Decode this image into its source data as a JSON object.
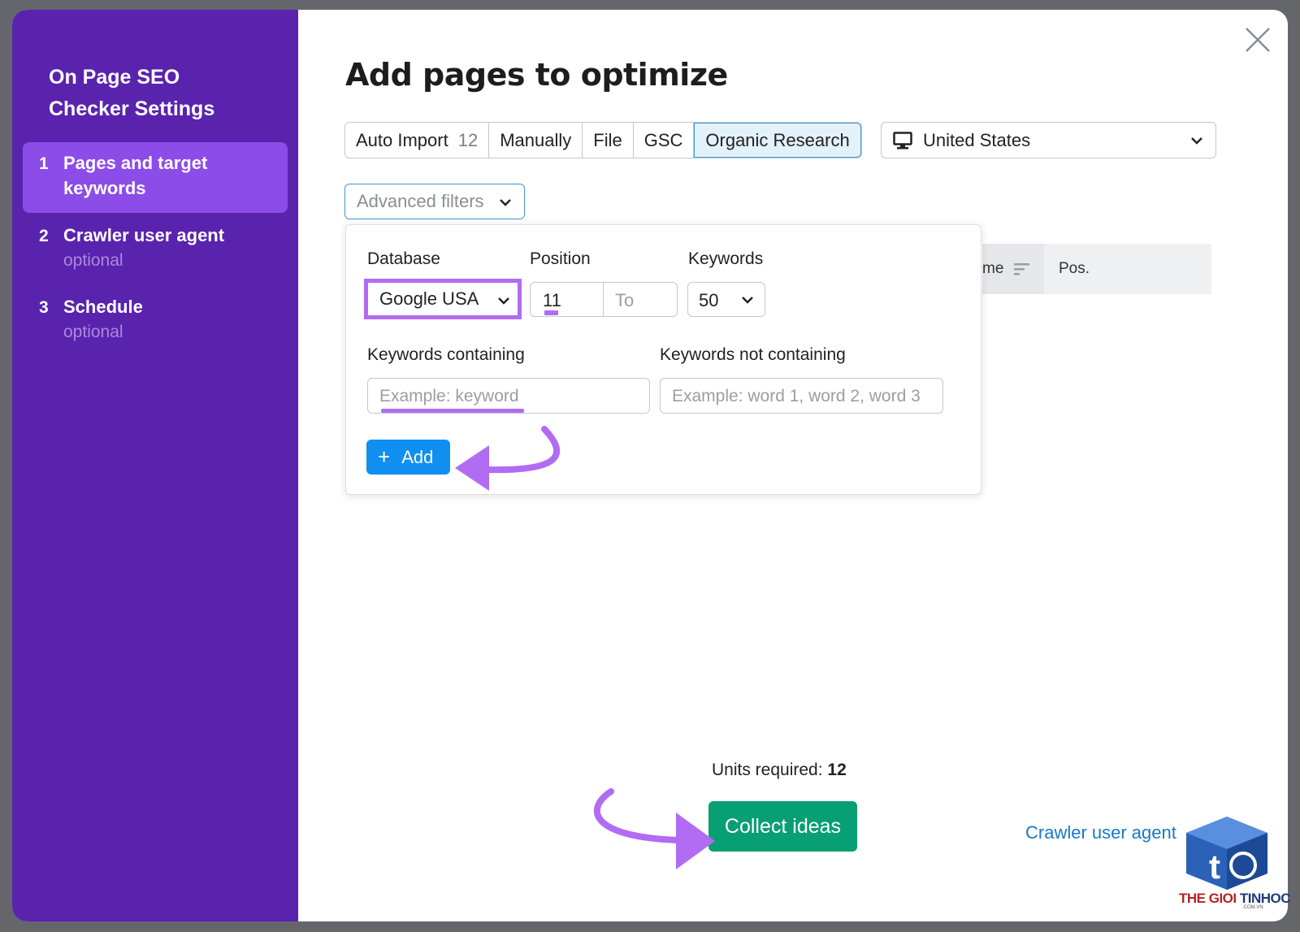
{
  "sidebar": {
    "title": "On Page SEO Checker Settings",
    "steps": [
      {
        "num": "1",
        "label": "Pages and target keywords",
        "optional": ""
      },
      {
        "num": "2",
        "label": "Crawler user agent",
        "optional": "optional"
      },
      {
        "num": "3",
        "label": "Schedule",
        "optional": "optional"
      }
    ]
  },
  "main": {
    "title": "Add pages to optimize",
    "tabs": [
      {
        "label": "Auto Import",
        "count": "12"
      },
      {
        "label": "Manually"
      },
      {
        "label": "File"
      },
      {
        "label": "GSC"
      },
      {
        "label": "Organic Research"
      }
    ],
    "country": "United States",
    "advanced_filters": "Advanced filters",
    "table_head": {
      "name_col": "me",
      "pos_col": "Pos."
    },
    "filters": {
      "database_label": "Database",
      "database_value": "Google USA",
      "position_label": "Position",
      "position_from": "11",
      "position_to_placeholder": "To",
      "keywords_label": "Keywords",
      "keywords_value": "50",
      "containing_label": "Keywords containing",
      "containing_placeholder": "Example: keyword",
      "not_containing_label": "Keywords not containing",
      "not_containing_placeholder": "Example: word 1, word 2, word 3",
      "add_label": "Add"
    },
    "units_label": "Units required:",
    "units_value": "12",
    "collect_label": "Collect ideas",
    "next_link": "Crawler user agent"
  },
  "watermark": {
    "brand_a": "THE GIOI",
    "brand_b": "TINHOC",
    "domain": ".COM.VN"
  },
  "colors": {
    "sidebar": "#5a23ae",
    "active_step": "#8c4ce8",
    "primary": "#0f8ff0",
    "collect": "#079f73",
    "highlight": "#b26cf3"
  }
}
